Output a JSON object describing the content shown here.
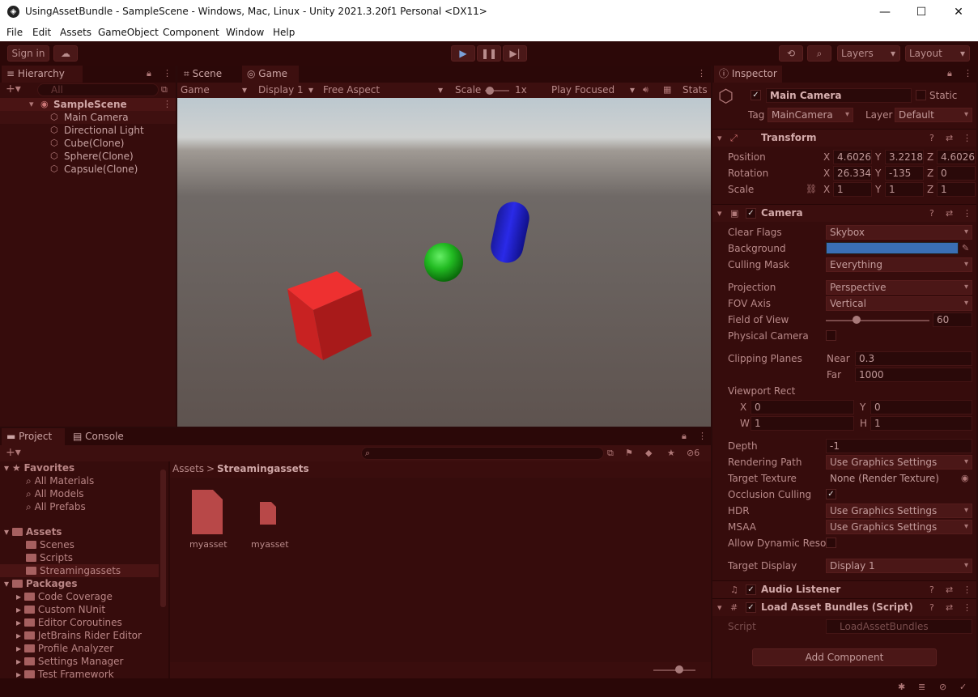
{
  "window": {
    "title": "UsingAssetBundle - SampleScene - Windows, Mac, Linux - Unity 2021.3.20f1 Personal <DX11>",
    "minimize": "—",
    "maximize": "☐",
    "close": "✕"
  },
  "menu": [
    "File",
    "Edit",
    "Assets",
    "GameObject",
    "Component",
    "Window",
    "Help"
  ],
  "toolbar": {
    "signin": "Sign in",
    "layers": "Layers",
    "layout": "Layout"
  },
  "hierarchy": {
    "tab": "Hierarchy",
    "search_placeholder": "All",
    "scene": "SampleScene",
    "items": [
      "Main Camera",
      "Directional Light",
      "Cube(Clone)",
      "Sphere(Clone)",
      "Capsule(Clone)"
    ]
  },
  "game": {
    "tab_scene": "Scene",
    "tab_game": "Game",
    "view": "Game",
    "display": "Display 1",
    "aspect": "Free Aspect",
    "scale_label": "Scale",
    "scale_value": "1x",
    "play_focused": "Play Focused",
    "stats": "Stats"
  },
  "project": {
    "tab_project": "Project",
    "tab_console": "Console",
    "badge": "6",
    "breadcrumb_root": "Assets",
    "breadcrumb_current": "Streamingassets",
    "favorites_label": "Favorites",
    "favorites": [
      "All Materials",
      "All Models",
      "All Prefabs"
    ],
    "assets_label": "Assets",
    "assets": [
      "Scenes",
      "Scripts",
      "Streamingassets"
    ],
    "packages_label": "Packages",
    "packages": [
      "Code Coverage",
      "Custom NUnit",
      "Editor Coroutines",
      "JetBrains Rider Editor",
      "Profile Analyzer",
      "Settings Manager",
      "Test Framework"
    ],
    "files": [
      "myasset",
      "myasset"
    ]
  },
  "inspector": {
    "tab": "Inspector",
    "object_name": "Main Camera",
    "static": "Static",
    "tag_label": "Tag",
    "tag": "MainCamera",
    "layer_label": "Layer",
    "layer": "Default",
    "transform": {
      "title": "Transform",
      "position_label": "Position",
      "rotation_label": "Rotation",
      "scale_label": "Scale",
      "position": [
        "4.6026",
        "3.2218",
        "4.6026"
      ],
      "rotation": [
        "26.334",
        "-135",
        "0"
      ],
      "scale": [
        "1",
        "1",
        "1"
      ],
      "axes": [
        "X",
        "Y",
        "Z"
      ]
    },
    "camera": {
      "title": "Camera",
      "clear_flags_label": "Clear Flags",
      "clear_flags": "Skybox",
      "background_label": "Background",
      "background_color": "#3a6fb5",
      "culling_mask_label": "Culling Mask",
      "culling_mask": "Everything",
      "projection_label": "Projection",
      "projection": "Perspective",
      "fov_axis_label": "FOV Axis",
      "fov_axis": "Vertical",
      "fov_label": "Field of View",
      "fov": "60",
      "fov_fraction": 0.3,
      "physical_label": "Physical Camera",
      "clipping_label": "Clipping Planes",
      "near_label": "Near",
      "near": "0.3",
      "far_label": "Far",
      "far": "1000",
      "viewport_label": "Viewport Rect",
      "vx": "0",
      "vy": "0",
      "vw": "1",
      "vh": "1",
      "x": "X",
      "y": "Y",
      "w": "W",
      "h": "H",
      "depth_label": "Depth",
      "depth": "-1",
      "rendering_path_label": "Rendering Path",
      "rendering_path": "Use Graphics Settings",
      "target_texture_label": "Target Texture",
      "target_texture": "None (Render Texture)",
      "occlusion_label": "Occlusion Culling",
      "hdr_label": "HDR",
      "hdr": "Use Graphics Settings",
      "msaa_label": "MSAA",
      "msaa": "Use Graphics Settings",
      "dynres_label": "Allow Dynamic Resol",
      "target_display_label": "Target Display",
      "target_display": "Display 1"
    },
    "audio_listener": "Audio Listener",
    "script_comp": {
      "title": "Load Asset Bundles (Script)",
      "script_label": "Script",
      "script": "LoadAssetBundles"
    },
    "add_component": "Add Component"
  }
}
